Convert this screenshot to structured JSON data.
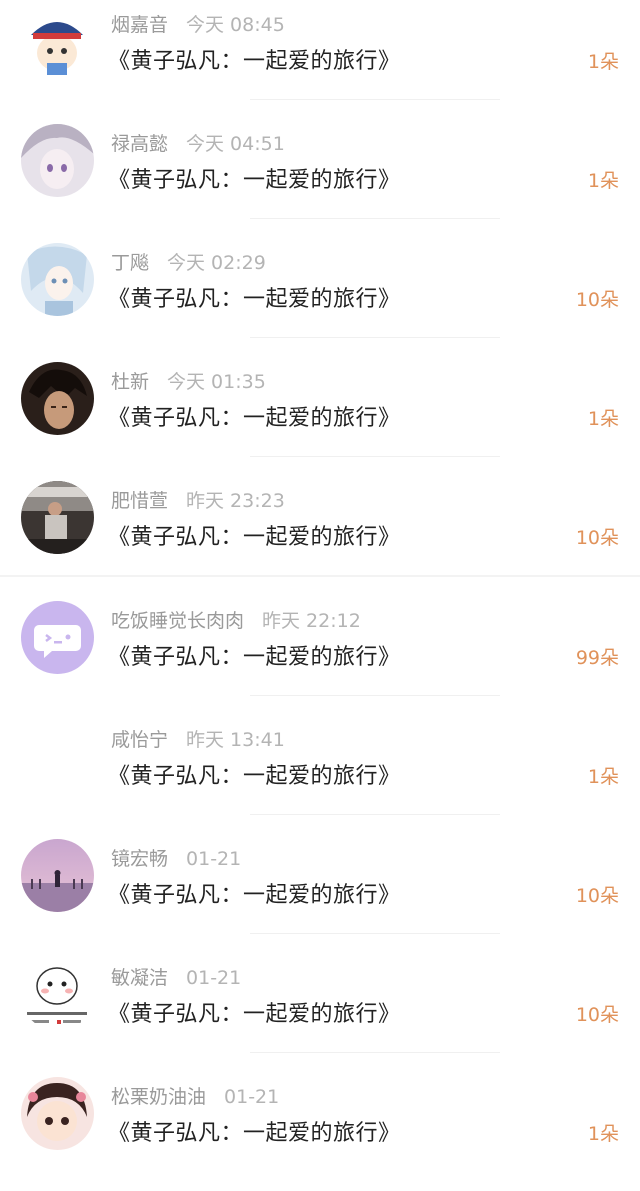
{
  "items": [
    {
      "name": "烟嘉音",
      "time": "今天 08:45",
      "title": "《黄子弘凡：一起爱的旅行》",
      "count": "1朵",
      "avatar_icon": "cartoon-hat-avatar"
    },
    {
      "name": "禄高懿",
      "time": "今天 04:51",
      "title": "《黄子弘凡：一起爱的旅行》",
      "count": "1朵",
      "avatar_icon": "anime-girl-avatar"
    },
    {
      "name": "丁飚",
      "time": "今天 02:29",
      "title": "《黄子弘凡：一起爱的旅行》",
      "count": "10朵",
      "avatar_icon": "anime-blue-avatar"
    },
    {
      "name": "杜新",
      "time": "今天 01:35",
      "title": "《黄子弘凡：一起爱的旅行》",
      "count": "1朵",
      "avatar_icon": "game-character-avatar"
    },
    {
      "name": "肥惜萱",
      "time": "昨天 23:23",
      "title": "《黄子弘凡：一起爱的旅行》",
      "count": "10朵",
      "avatar_icon": "photo-person-avatar"
    },
    {
      "name": "吃饭睡觉长肉肉",
      "time": "昨天 22:12",
      "title": "《黄子弘凡：一起爱的旅行》",
      "count": "99朵",
      "avatar_icon": "chat-bubble-avatar"
    },
    {
      "name": "咸怡宁",
      "time": "昨天 13:41",
      "title": "《黄子弘凡：一起爱的旅行》",
      "count": "1朵",
      "avatar_icon": "none"
    },
    {
      "name": "镜宏畅",
      "time": "01-21",
      "title": "《黄子弘凡：一起爱的旅行》",
      "count": "10朵",
      "avatar_icon": "sunset-pier-avatar"
    },
    {
      "name": "敏凝洁",
      "time": "01-21",
      "title": "《黄子弘凡：一起爱的旅行》",
      "count": "10朵",
      "avatar_icon": "meme-face-avatar"
    },
    {
      "name": "松栗奶油油",
      "time": "01-21",
      "title": "《黄子弘凡：一起爱的旅行》",
      "count": "1朵",
      "avatar_icon": "chibi-girl-avatar"
    }
  ],
  "colors": {
    "name": "#9a9a9a",
    "count": "#e0925a",
    "title": "#222222",
    "chat_bubble_bg": "#c9b6ee"
  }
}
